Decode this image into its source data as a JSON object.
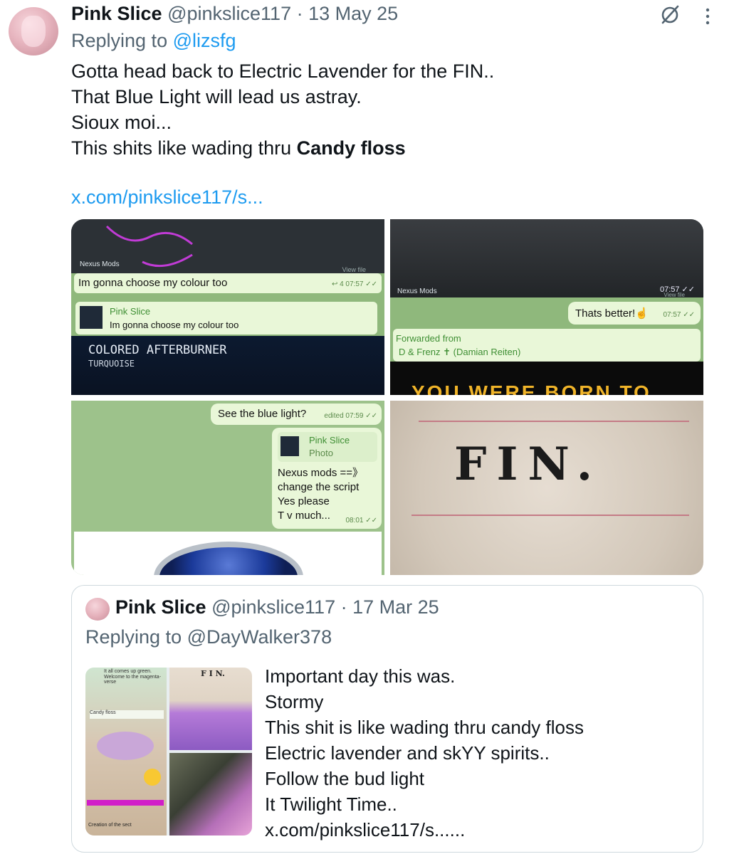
{
  "tweet": {
    "display_name": "Pink Slice",
    "handle": "@pinkslice117",
    "separator": "·",
    "date": "13 May 25",
    "replying_prefix": "Replying to",
    "replying_to": "@lizsfg",
    "lines": [
      "Gotta head back to Electric Lavender for the FIN..",
      "That Blue Light will lead us astray.",
      "Sioux moi..."
    ],
    "line4_prefix": "This shits like wading thru ",
    "line4_bold": "Candy floss",
    "link": "x.com/pinkslice117/s..."
  },
  "media": {
    "tile1": {
      "app_label": "Nexus Mods",
      "view_file": "View file",
      "message": "Im gonna choose my colour too",
      "meta": "↩ 4  07:57 ✓✓",
      "reply_name": "Pink Slice",
      "reply_text": "Im gonna choose my colour too",
      "banner_title": "COLORED AFTERBURNER",
      "banner_sub": "TURQUOISE"
    },
    "tile2": {
      "app_label": "Nexus Mods",
      "time_top": "07:57 ✓✓",
      "view_file": "View file",
      "message": "Thats better!☝",
      "meta": "07:57 ✓✓",
      "forwarded_label": "Forwarded from",
      "forwarded_from": "D & Frenz ✝ (Damian Reiten)",
      "banner_text": "YOU WERE BORN TO"
    },
    "tile3": {
      "message": "See the blue light?",
      "meta": "edited 07:59 ✓✓",
      "reply_name": "Pink Slice",
      "reply_kind": "Photo",
      "lines": [
        "Nexus mods ==》",
        "change the script",
        "Yes please",
        "T v much..."
      ],
      "meta2": "08:01 ✓✓"
    },
    "tile4": {
      "text": "FIN."
    }
  },
  "quote": {
    "display_name": "Pink Slice",
    "handle": "@pinkslice117",
    "separator": "·",
    "date": "17 Mar 25",
    "replying_prefix": "Replying to",
    "replying_to": "@DayWalker378",
    "lines": [
      "Important day this was.",
      "Stormy",
      "This shit is like wading thru candy floss",
      "Electric lavender and skYY spirits..",
      "Follow the bud light",
      "It Twilight Time..",
      "x.com/pinkslice117/s......"
    ],
    "thumb_fin": "F I N.",
    "thumb_caption1": "It all comes up green.",
    "thumb_caption2": "Welcome to the magenta-verse",
    "thumb_caption3": "Candy floss",
    "thumb_caption4": "Creation of the sect"
  },
  "colors": {
    "link": "#1d9bf0",
    "muted": "#536471",
    "text": "#0f1419",
    "telegram_bubble": "#e9f7d8",
    "telegram_bg": "#8fb87c"
  },
  "icons": [
    "grok-icon",
    "more-vertical-icon"
  ]
}
